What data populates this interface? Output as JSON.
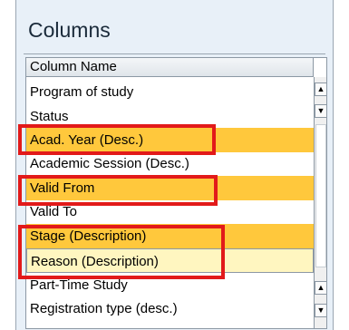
{
  "panel": {
    "title": "Columns"
  },
  "table": {
    "header": "Column Name",
    "rows": [
      {
        "label": "Program of study"
      },
      {
        "label": "Status"
      },
      {
        "label": "Acad. Year (Desc.)"
      },
      {
        "label": "Academic Session (Desc.)"
      },
      {
        "label": "Valid From"
      },
      {
        "label": "Valid To"
      },
      {
        "label": "Stage (Description)"
      },
      {
        "label": "Reason (Description)"
      },
      {
        "label": "Part-Time Study"
      },
      {
        "label": "Registration type (desc.)"
      }
    ]
  },
  "scrollbar": {
    "up_icon": "triangle-up-icon",
    "down_icon": "triangle-down-icon"
  },
  "colors": {
    "selected_row": "#ffc83c",
    "focused_row": "#fff6c0",
    "highlight_box": "#e21a1a"
  }
}
